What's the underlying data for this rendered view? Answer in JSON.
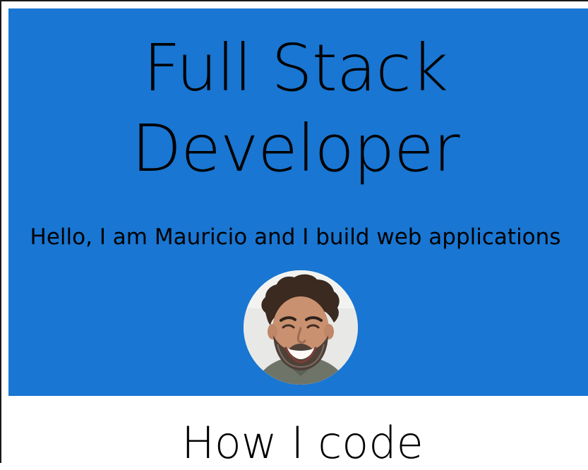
{
  "hero": {
    "title_line1": "Full Stack",
    "title_line2": "Developer",
    "subtitle": "Hello, I am Mauricio and I build web applications",
    "background_color": "#1976d2"
  },
  "avatar": {
    "alt": "Mauricio"
  },
  "section": {
    "title": "How I code"
  }
}
